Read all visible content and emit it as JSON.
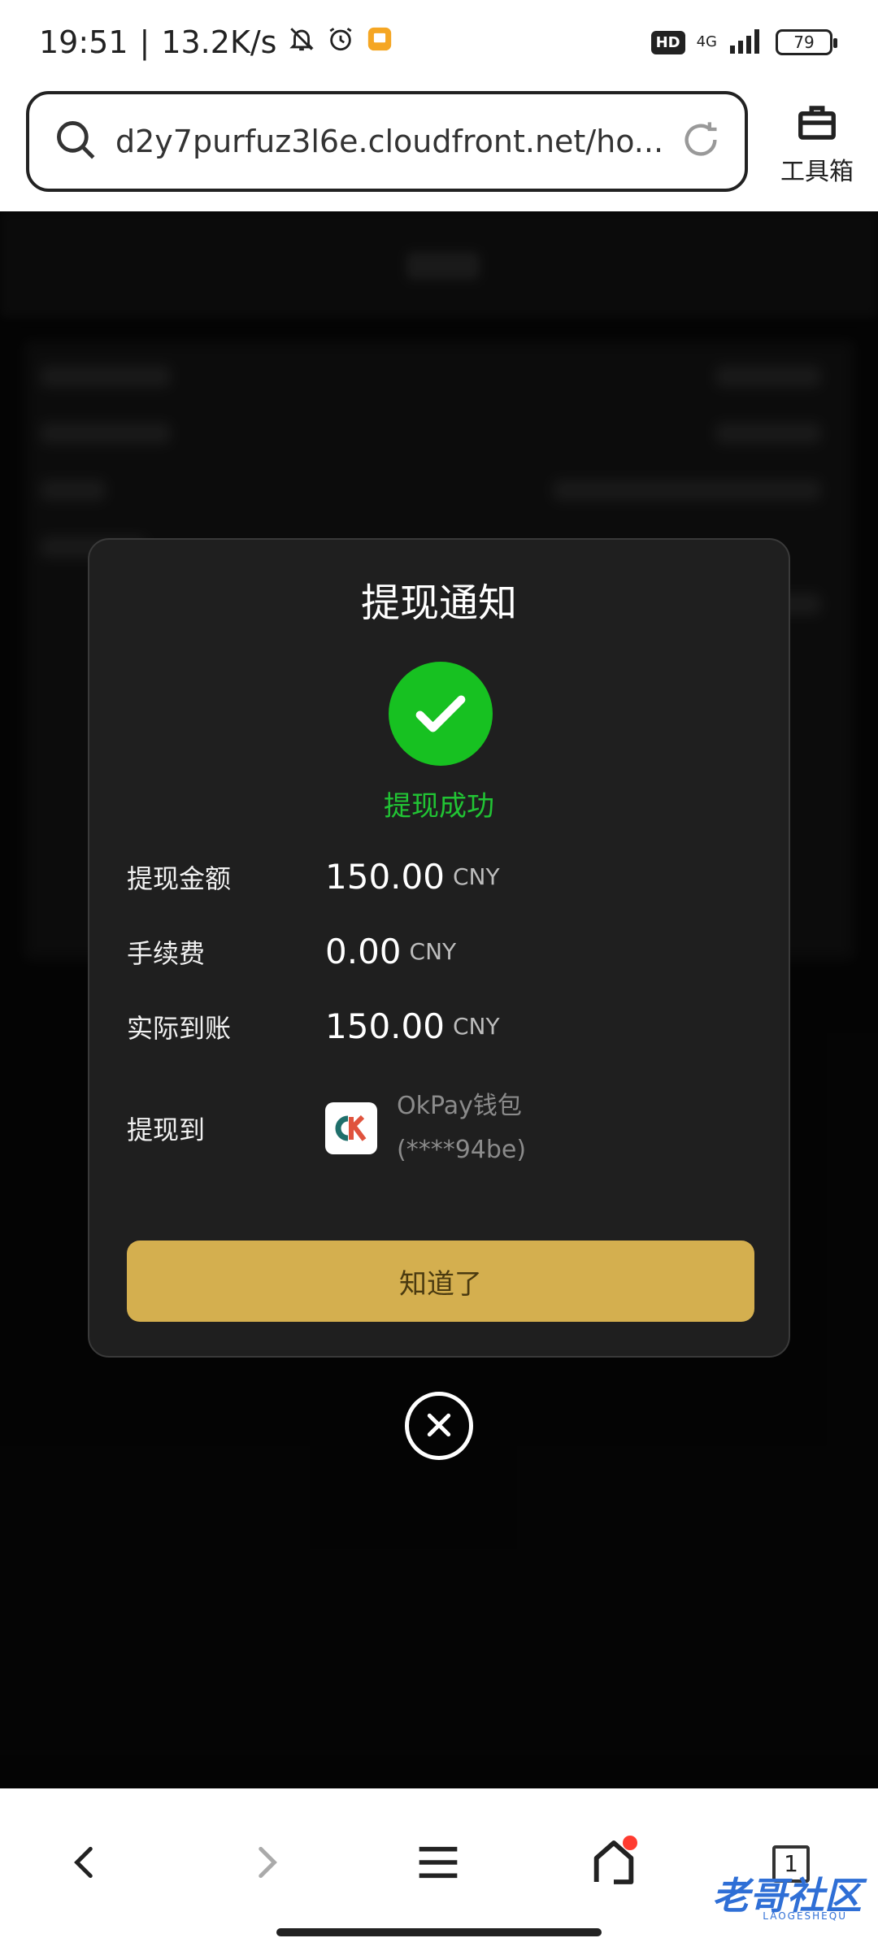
{
  "status_bar": {
    "time": "19:51",
    "net_speed": "13.2K/s",
    "hd": "HD",
    "net_type": "4G",
    "battery": "79"
  },
  "browser": {
    "url": "d2y7purfuz3l6e.cloudfront.net/ho...",
    "toolbox_label": "工具箱"
  },
  "modal": {
    "title": "提现通知",
    "status_text": "提现成功",
    "rows": [
      {
        "label": "提现金额",
        "value": "150.00",
        "unit": "CNY"
      },
      {
        "label": "手续费",
        "value": "0.00",
        "unit": "CNY"
      },
      {
        "label": "实际到账",
        "value": "150.00",
        "unit": "CNY"
      }
    ],
    "destination": {
      "label": "提现到",
      "wallet_name": "OkPay钱包",
      "account": "(****94be)"
    },
    "confirm_label": "知道了"
  },
  "bottom_nav": {
    "tab_count": "1"
  },
  "watermark": {
    "text": "老哥社区",
    "sub": "LAOGESHEQU"
  },
  "colors": {
    "success_green": "#17c121",
    "button_gold": "#d4af4f",
    "modal_bg": "#1f1f1f"
  }
}
